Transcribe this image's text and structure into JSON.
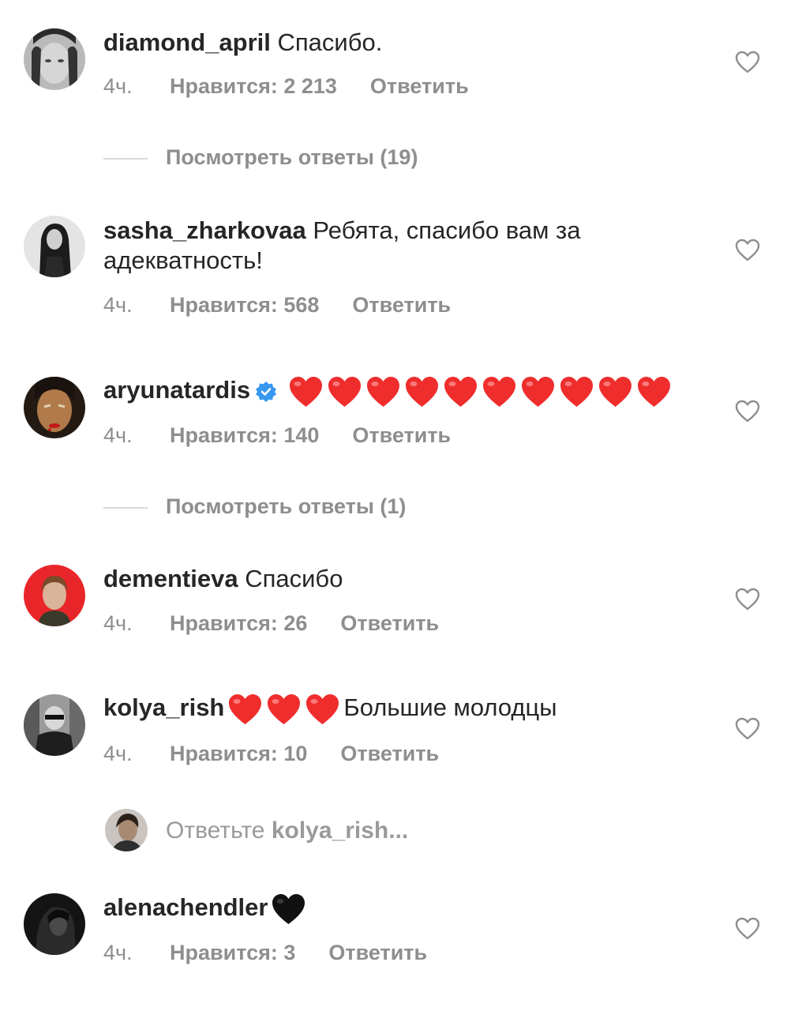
{
  "comments": [
    {
      "username": "diamond_april",
      "text": "Спасибо.",
      "time": "4ч.",
      "likes": "Нравится: 2 213",
      "reply": "Ответить",
      "hearts": 0
    },
    {
      "username": "sasha_zharkovaa",
      "text": "Ребята, спасибо вам за",
      "text2": "адекватность!",
      "time": "4ч.",
      "likes": "Нравится: 568",
      "reply": "Ответить",
      "hearts": 0
    },
    {
      "username": "aryunatardis",
      "verified": true,
      "text": "",
      "time": "4ч.",
      "likes": "Нравится: 140",
      "reply": "Ответить",
      "hearts": 10
    },
    {
      "username": "dementieva",
      "text": "Спасибо",
      "time": "4ч.",
      "likes": "Нравится: 26",
      "reply": "Ответить",
      "hearts": 0
    },
    {
      "username": "kolya_rish",
      "text": "Большие молодцы",
      "time": "4ч.",
      "likes": "Нравится: 10",
      "reply": "Ответить",
      "hearts": 3
    },
    {
      "username": "alenachendler",
      "text": "",
      "time": "4ч.",
      "likes": "Нравится: 3",
      "reply": "Ответить",
      "hearts": 0,
      "black_heart": true
    }
  ],
  "view_replies": [
    "Посмотреть ответы (19)",
    "Посмотреть ответы (1)"
  ],
  "reply_input": {
    "prefix": "Ответьте",
    "target": "kolya_rish..."
  },
  "colors": {
    "text": "#262626",
    "secondary": "#8e8e8e",
    "red_heart": "#ef2d2d",
    "verified": "#3897f0"
  },
  "icons": {
    "like": "heart-outline-icon",
    "verified": "verified-badge-icon",
    "emoji": "red-heart-emoji",
    "emoji_black": "black-heart-emoji"
  }
}
